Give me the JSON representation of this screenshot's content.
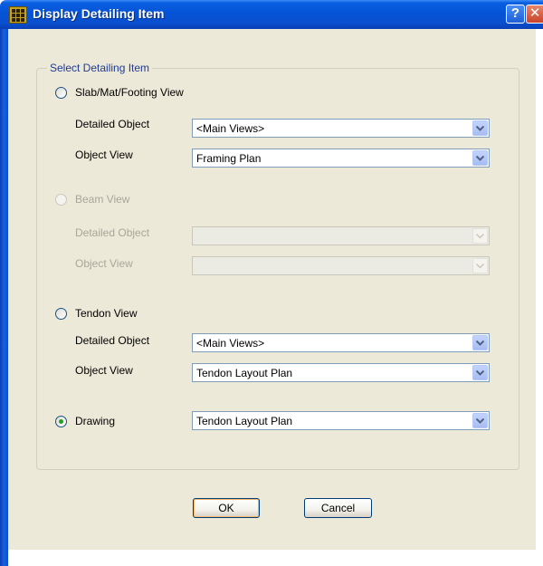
{
  "window": {
    "title": "Display Detailing Item",
    "help_glyph": "?",
    "close_glyph": "✕"
  },
  "group": {
    "legend": "Select Detailing Item",
    "slab": {
      "label": "Slab/Mat/Footing View",
      "selected": false,
      "detailed_object_label": "Detailed Object",
      "detailed_object_value": "<Main Views>",
      "object_view_label": "Object View",
      "object_view_value": "Framing Plan"
    },
    "beam": {
      "label": "Beam View",
      "enabled": false,
      "detailed_object_label": "Detailed Object",
      "detailed_object_value": "",
      "object_view_label": "Object View",
      "object_view_value": ""
    },
    "tendon": {
      "label": "Tendon View",
      "selected": false,
      "detailed_object_label": "Detailed Object",
      "detailed_object_value": "<Main Views>",
      "object_view_label": "Object View",
      "object_view_value": "Tendon Layout Plan"
    },
    "drawing": {
      "label": "Drawing",
      "selected": true,
      "value": "Tendon Layout Plan"
    }
  },
  "buttons": {
    "ok": "OK",
    "cancel": "Cancel"
  },
  "colors": {
    "titlebar": "#0553d6",
    "panel": "#ece9d8",
    "legend_text": "#1f3a93",
    "radio_dot": "#21a121"
  }
}
